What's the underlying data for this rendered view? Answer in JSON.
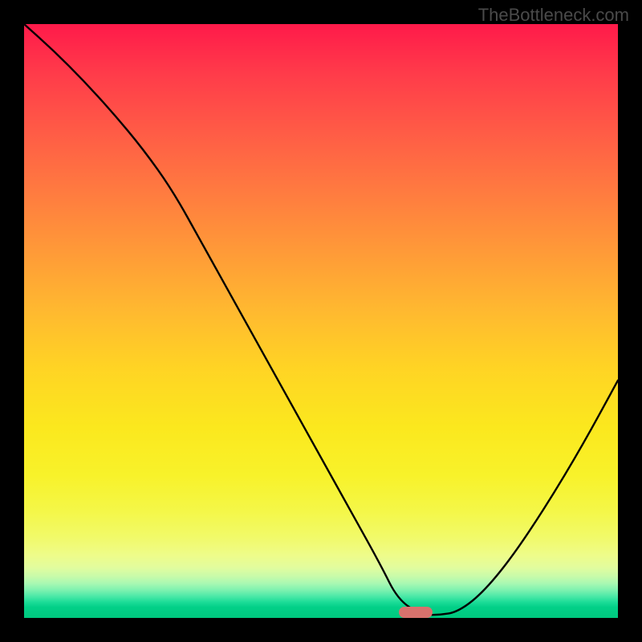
{
  "watermark": "TheBottleneck.com",
  "chart_data": {
    "type": "line",
    "title": "",
    "xlabel": "",
    "ylabel": "",
    "xlim": [
      0,
      100
    ],
    "ylim": [
      0,
      100
    ],
    "x": [
      0,
      5,
      10,
      15,
      20,
      25,
      30,
      35,
      40,
      45,
      50,
      55,
      60,
      63,
      67,
      70,
      73,
      77,
      82,
      88,
      94,
      100
    ],
    "values": [
      100,
      95.5,
      90.5,
      85,
      79,
      72,
      63,
      54,
      45,
      36,
      27,
      18,
      9,
      3,
      0.5,
      0.5,
      1,
      4,
      10,
      19,
      29,
      40
    ],
    "gradient": "green-yellow-red (bottom to top)",
    "annotations": [
      {
        "type": "marker",
        "x_center": 66,
        "y": 1,
        "color": "#d8726d",
        "shape": "rounded-bar"
      }
    ]
  }
}
